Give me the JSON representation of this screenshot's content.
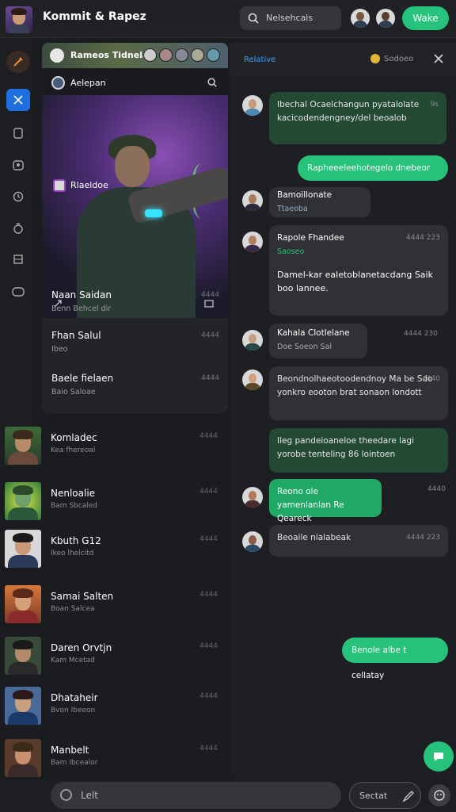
{
  "header": {
    "title": "Kommit & Rapez",
    "search_label": "Nelsehcals",
    "wake_button": "Wake"
  },
  "panel": {
    "community_name": "Rameos Tidnelar",
    "channel_name": "Aelepan",
    "featured_name": "Rlaeldoe",
    "rows": [
      {
        "name": "Naan Saidan",
        "sub": "Benn  Behcel dir",
        "time": "4444"
      },
      {
        "name": "Fhan Salul",
        "sub": "Ibeo",
        "time": "4444"
      },
      {
        "name": "Baele fielaen",
        "sub": "Baio  Saloae",
        "time": "4444"
      }
    ]
  },
  "list": [
    {
      "name": "Komladec",
      "sub": "Kea  fhereoal",
      "time": "4444"
    },
    {
      "name": "Nenloalie",
      "sub": "Bam  Sbcaled",
      "time": "4444"
    },
    {
      "name": "Kbuth G12",
      "sub": "Ikeo  lhelcitd",
      "time": "4444"
    },
    {
      "name": "Samai Salten",
      "sub": "Boan  Salcea",
      "time": "4444"
    },
    {
      "name": "Daren Orvtjn",
      "sub": "Kam  Mcetad",
      "time": "4444"
    },
    {
      "name": "Dhataheir",
      "sub": "Bvon  Ibeeon",
      "time": "4444"
    },
    {
      "name": "Manbelt",
      "sub": "Bam  Ibcealor",
      "time": "4444"
    }
  ],
  "chat": {
    "title": "Relative",
    "count": "Sodoeo",
    "messages": [
      {
        "text": "Ibechal  Ocaelchangun  pyatalolate kacicodendengney/del beoalob",
        "time": "9s"
      },
      {
        "out": "Rapheeeleehotegelo dnebeor"
      },
      {
        "name": "Bamoillonate",
        "sub": "Ttaeoba"
      },
      {
        "name": "Rapole Fhandee",
        "sub": "Saoseo",
        "time": "4444 223",
        "text": "Damel-kar ealetoblanetacdang Saik  boo lannee."
      },
      {
        "name": "Kahala Clotlelane",
        "sub": "Doe  Soeon  Sal",
        "time": "4444 230"
      },
      {
        "text": "Beondnolhaeotoodendnoy Ma be Sdo  yonkro eooton brat sonaon  londott",
        "time": "4440"
      },
      {
        "text": "Ileg pandeioaneloe theedare lagi  yorobe tenteling 86 lointoen"
      },
      {
        "text": "Reono ole yamenlanlan  Re Qeareck",
        "time": "4440"
      },
      {
        "text": "Beoaile nialabeak",
        "time": "4444 223"
      },
      {
        "out": "Benole albe t cellatay"
      }
    ]
  },
  "composer": {
    "placeholder": "Lelt",
    "send_label": "Sectat"
  }
}
